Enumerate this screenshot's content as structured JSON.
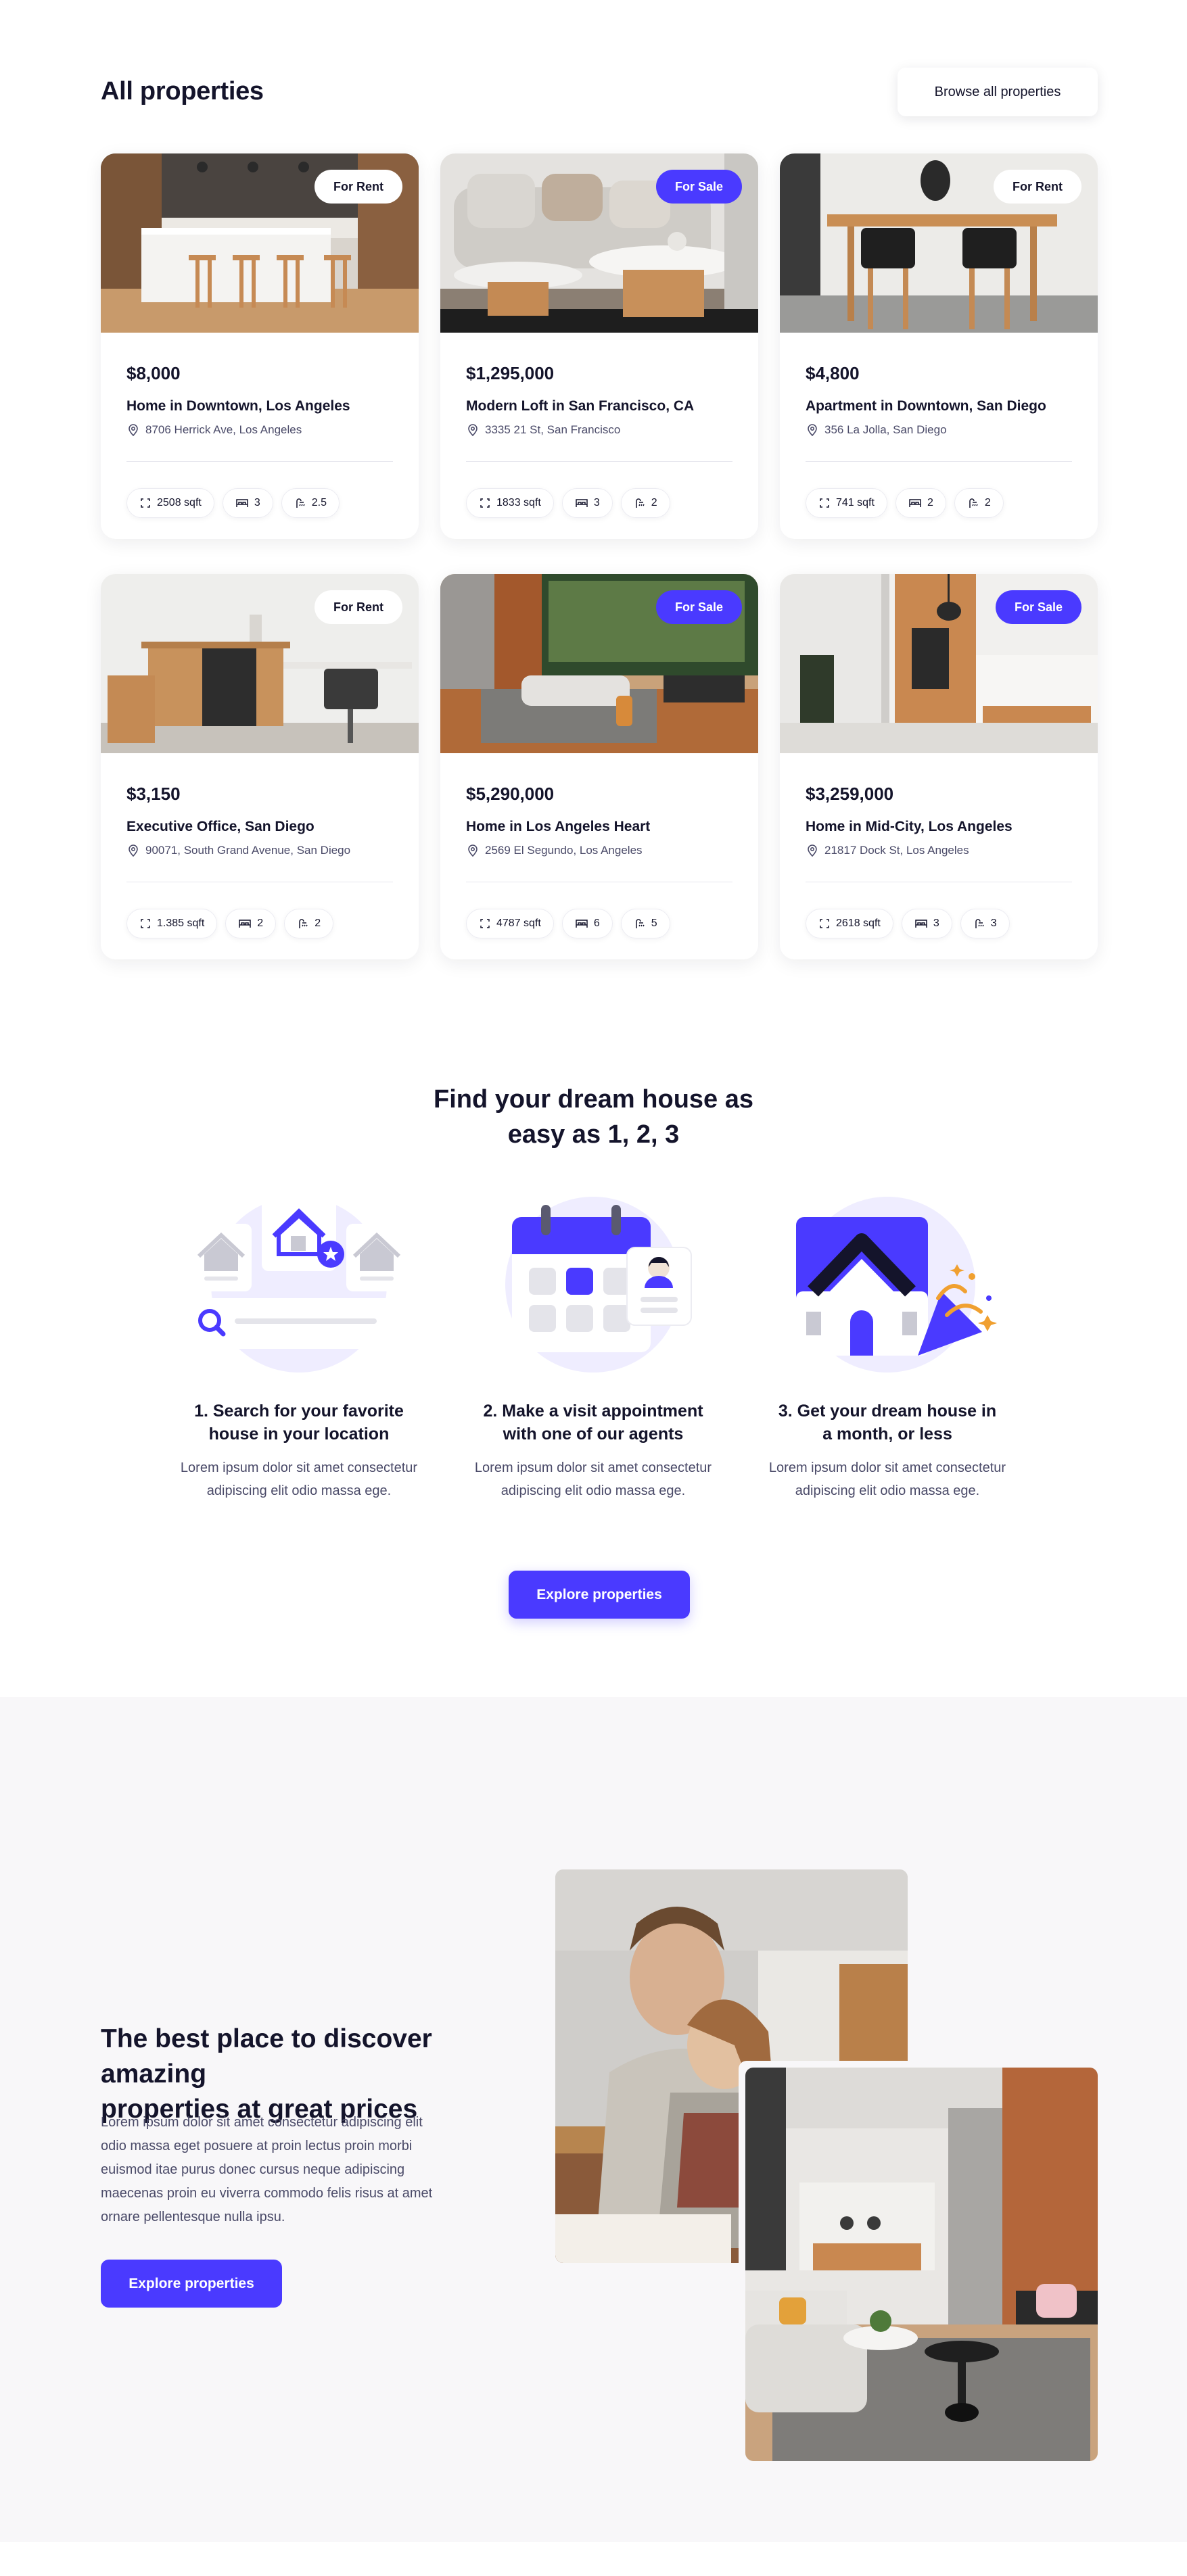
{
  "properties": {
    "title": "All properties",
    "browse_label": "Browse all properties",
    "cards": [
      {
        "badge": "For Rent",
        "price": "$8,000",
        "name": "Home in Downtown, Los Angeles",
        "address": "8706 Herrick Ave, Los Angeles",
        "sqft": "2508 sqft",
        "beds": "3",
        "baths": "2.5"
      },
      {
        "badge": "For Sale",
        "price": "$1,295,000",
        "name": "Modern Loft in San Francisco, CA",
        "address": "3335 21 St, San Francisco",
        "sqft": "1833 sqft",
        "beds": "3",
        "baths": "2"
      },
      {
        "badge": "For Rent",
        "price": "$4,800",
        "name": "Apartment in Downtown, San Diego",
        "address": "356 La Jolla, San Diego",
        "sqft": "741 sqft",
        "beds": "2",
        "baths": "2"
      },
      {
        "badge": "For Rent",
        "price": "$3,150",
        "name": "Executive Office, San Diego",
        "address": "90071, South Grand Avenue, San Diego",
        "sqft": "1.385 sqft",
        "beds": "2",
        "baths": "2"
      },
      {
        "badge": "For Sale",
        "price": "$5,290,000",
        "name": "Home in Los Angeles Heart",
        "address": "2569 El Segundo, Los Angeles",
        "sqft": "4787 sqft",
        "beds": "6",
        "baths": "5"
      },
      {
        "badge": "For Sale",
        "price": "$3,259,000",
        "name": "Home in Mid-City, Los Angeles",
        "address": "21817 Dock St, Los Angeles",
        "sqft": "2618 sqft",
        "beds": "3",
        "baths": "3"
      }
    ]
  },
  "steps": {
    "title_line1": "Find your dream house as",
    "title_line2": "easy as 1, 2, 3",
    "items": [
      {
        "title_line1": "1. Search for your favorite",
        "title_line2": "house in your location",
        "desc_line1": "Lorem ipsum dolor sit amet consectetur",
        "desc_line2": "adipiscing elit odio massa ege."
      },
      {
        "title_line1": "2. Make a visit appointment",
        "title_line2": "with one of our agents",
        "desc_line1": "Lorem ipsum dolor sit amet consectetur",
        "desc_line2": "adipiscing elit odio massa ege."
      },
      {
        "title_line1": "3. Get your dream house in",
        "title_line2": "a month, or less",
        "desc_line1": "Lorem ipsum dolor sit amet consectetur",
        "desc_line2": "adipiscing elit odio massa ege."
      }
    ],
    "cta_label": "Explore properties"
  },
  "best": {
    "title_line1": "The best place to discover amazing",
    "title_line2": "properties at great prices",
    "desc_lines": [
      "Lorem ipsum dolor sit amet consectetur adipiscing elit",
      "odio massa eget posuere at proin lectus proin morbi",
      "euismod itae purus donec cursus neque adipiscing",
      "maecenas proin eu viverra commodo felis risus at amet",
      "ornare pellentesque nulla ipsu."
    ],
    "cta_label": "Explore properties"
  },
  "colors": {
    "accent": "#4a3aff",
    "text": "#14142b",
    "muted": "#4a4a68",
    "section_bg": "#f8f7f9"
  }
}
